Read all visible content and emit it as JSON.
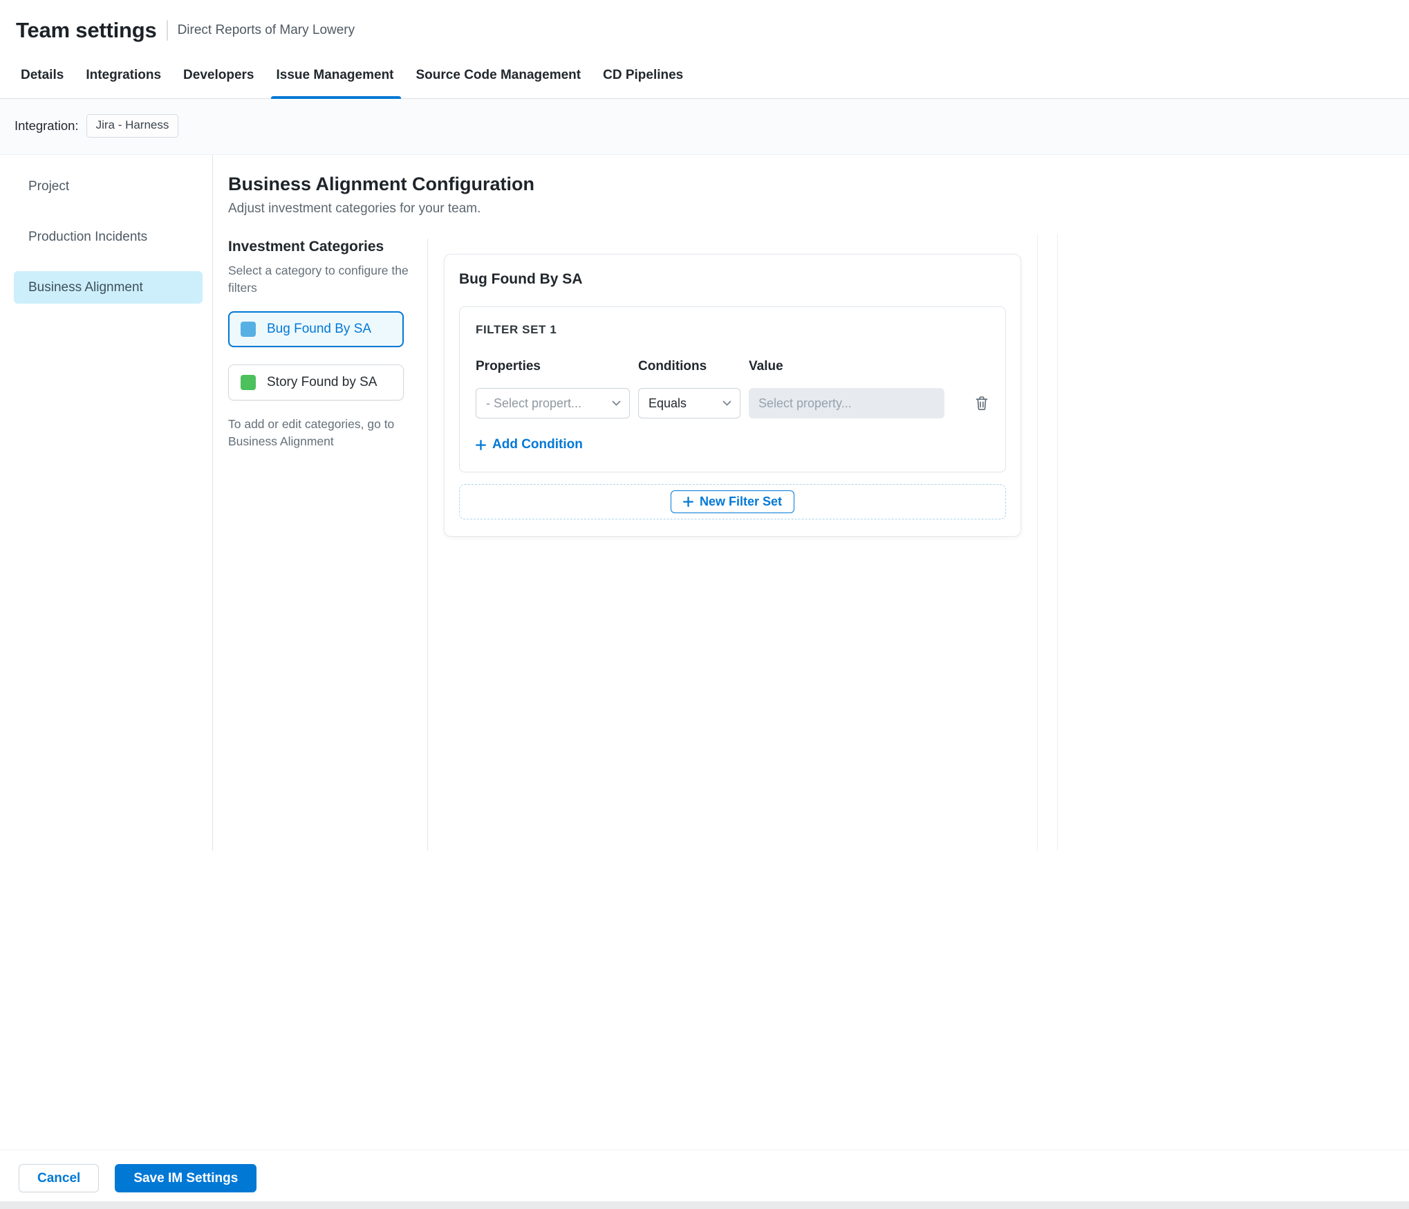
{
  "colors": {
    "accent": "#0278d5",
    "selected-nav-bg": "#cdeffb",
    "selected-category-bg": "#eef9fe",
    "category-blue": "#57b0e3",
    "category-green": "#4cc05a",
    "disabled-input-bg": "#e7ebef",
    "dashed-border": "#a9d4ee"
  },
  "header": {
    "title": "Team settings",
    "subtitle": "Direct Reports of Mary Lowery"
  },
  "tabs": {
    "items": [
      {
        "label": "Details",
        "active": false
      },
      {
        "label": "Integrations",
        "active": false
      },
      {
        "label": "Developers",
        "active": false
      },
      {
        "label": "Issue Management",
        "active": true
      },
      {
        "label": "Source Code Management",
        "active": false
      },
      {
        "label": "CD Pipelines",
        "active": false
      }
    ]
  },
  "integration": {
    "label": "Integration:",
    "value": "Jira - Harness"
  },
  "sidebar": {
    "items": [
      {
        "label": "Project",
        "selected": false
      },
      {
        "label": "Production Incidents",
        "selected": false
      },
      {
        "label": "Business Alignment",
        "selected": true
      }
    ]
  },
  "main": {
    "heading": "Business Alignment Configuration",
    "subheading": "Adjust investment categories for your team.",
    "categories": {
      "title": "Investment Categories",
      "help": "Select a category to configure the filters",
      "items": [
        {
          "label": "Bug Found By SA",
          "color": "#57b0e3",
          "selected": true
        },
        {
          "label": "Story Found by SA",
          "color": "#4cc05a",
          "selected": false
        }
      ],
      "footnote": "To add or edit categories, go to Business Alignment"
    },
    "filter_panel": {
      "title": "Bug Found By SA",
      "filter_set": {
        "title": "FILTER SET 1",
        "columns": [
          "Properties",
          "Conditions",
          "Value"
        ],
        "property_select_value": "- Select propert...",
        "condition_select_value": "Equals",
        "value_placeholder": "Select property...",
        "add_condition_label": "Add Condition"
      },
      "new_filter_set_label": "New Filter Set"
    }
  },
  "footer": {
    "cancel_label": "Cancel",
    "save_label": "Save IM Settings"
  }
}
